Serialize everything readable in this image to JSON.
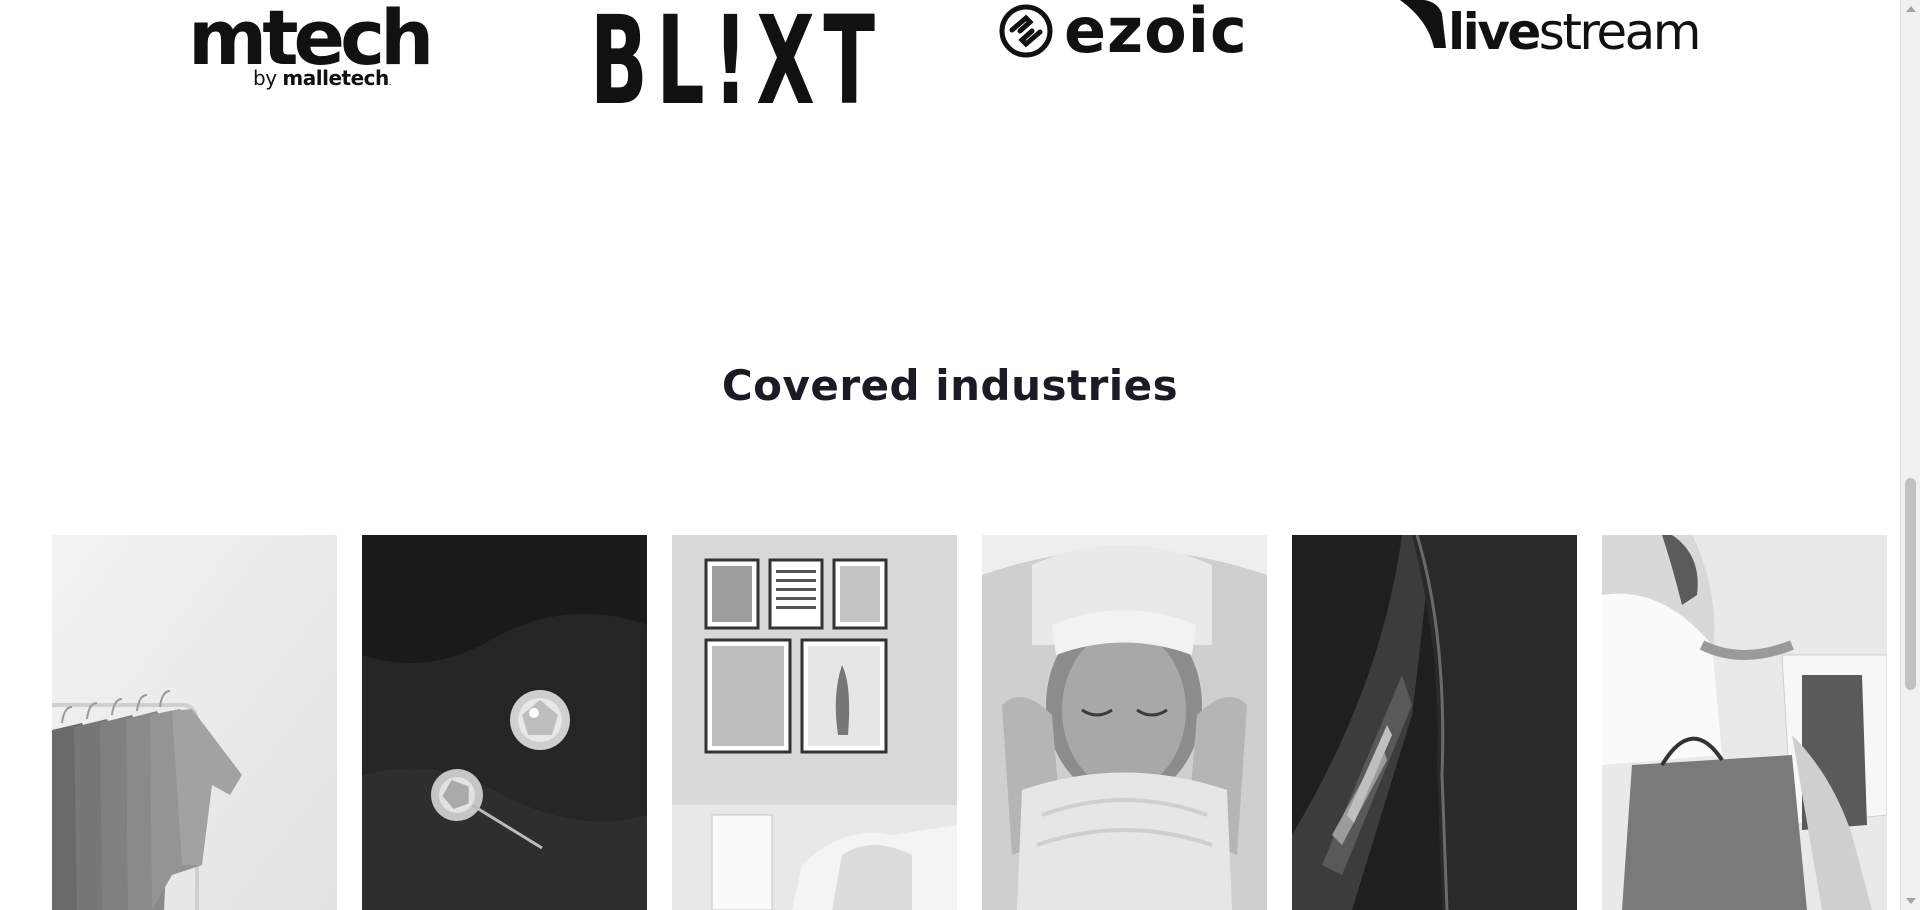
{
  "partners": [
    {
      "name": "mtech",
      "line1": "mtech",
      "by": "by",
      "sub": "malletech",
      "mark": "mtech-logo"
    },
    {
      "name": "BLIXT",
      "text": "BL!XT",
      "mark": "blixt-logo"
    },
    {
      "name": "ezoic",
      "text": "ezoic",
      "mark": "ezoic-logo"
    },
    {
      "name": "livestream",
      "text": "livestream",
      "mark": "livestream-logo"
    }
  ],
  "section": {
    "title": "Covered industries"
  },
  "industries": [
    {
      "image": "clothing-rack-photo"
    },
    {
      "image": "diamond-earrings-photo"
    },
    {
      "image": "wall-posters-photo"
    },
    {
      "image": "facial-spa-photo"
    },
    {
      "image": "car-headlight-photo"
    },
    {
      "image": "shopping-bags-photo"
    }
  ],
  "scrollbar": {
    "position_percent": 52
  }
}
